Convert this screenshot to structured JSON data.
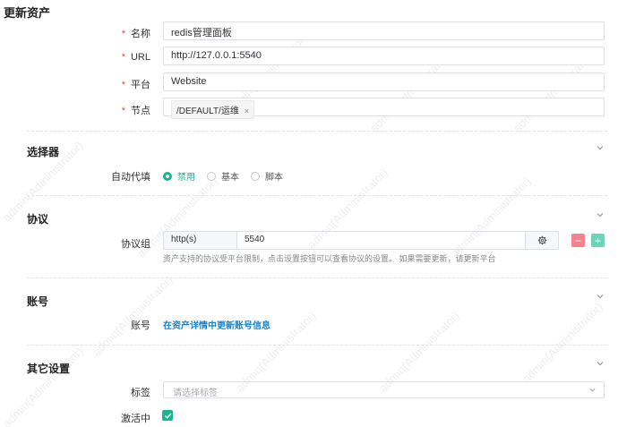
{
  "page": {
    "title": "更新资产"
  },
  "watermark": {
    "text": "admin(Administrator)"
  },
  "basic": {
    "name": {
      "label": "名称",
      "value": "redis管理面板"
    },
    "url": {
      "label": "URL",
      "value": "http://127.0.0.1:5540"
    },
    "platform": {
      "label": "平台",
      "value": "Website"
    },
    "node": {
      "label": "节点",
      "tag": "/DEFAULT/运维",
      "tag_remove": "×"
    }
  },
  "selector": {
    "title": "选择器",
    "autofill": {
      "label": "自动代填",
      "options": [
        "禁用",
        "基本",
        "脚本"
      ],
      "selected": "禁用"
    }
  },
  "protocol": {
    "title": "协议",
    "group_label": "协议组",
    "protocol": "http(s)",
    "port": "5540",
    "hint": "资产支持的协议受平台限制，点击设置按钮可以查看协议的设置。 如果需要更新，请更新平台",
    "minus": "−",
    "plus": "+"
  },
  "account": {
    "title": "账号",
    "label": "账号",
    "link": "在资产详情中更新账号信息"
  },
  "other": {
    "title": "其它设置",
    "labels_label": "标签",
    "labels_placeholder": "请选择标签",
    "active_label": "激活中",
    "active": true
  },
  "colors": {
    "accent": "#1ab394",
    "link": "#1c84c6",
    "required": "#e74c3c",
    "minus": "#f1848f",
    "plus": "#6dd4b7"
  }
}
